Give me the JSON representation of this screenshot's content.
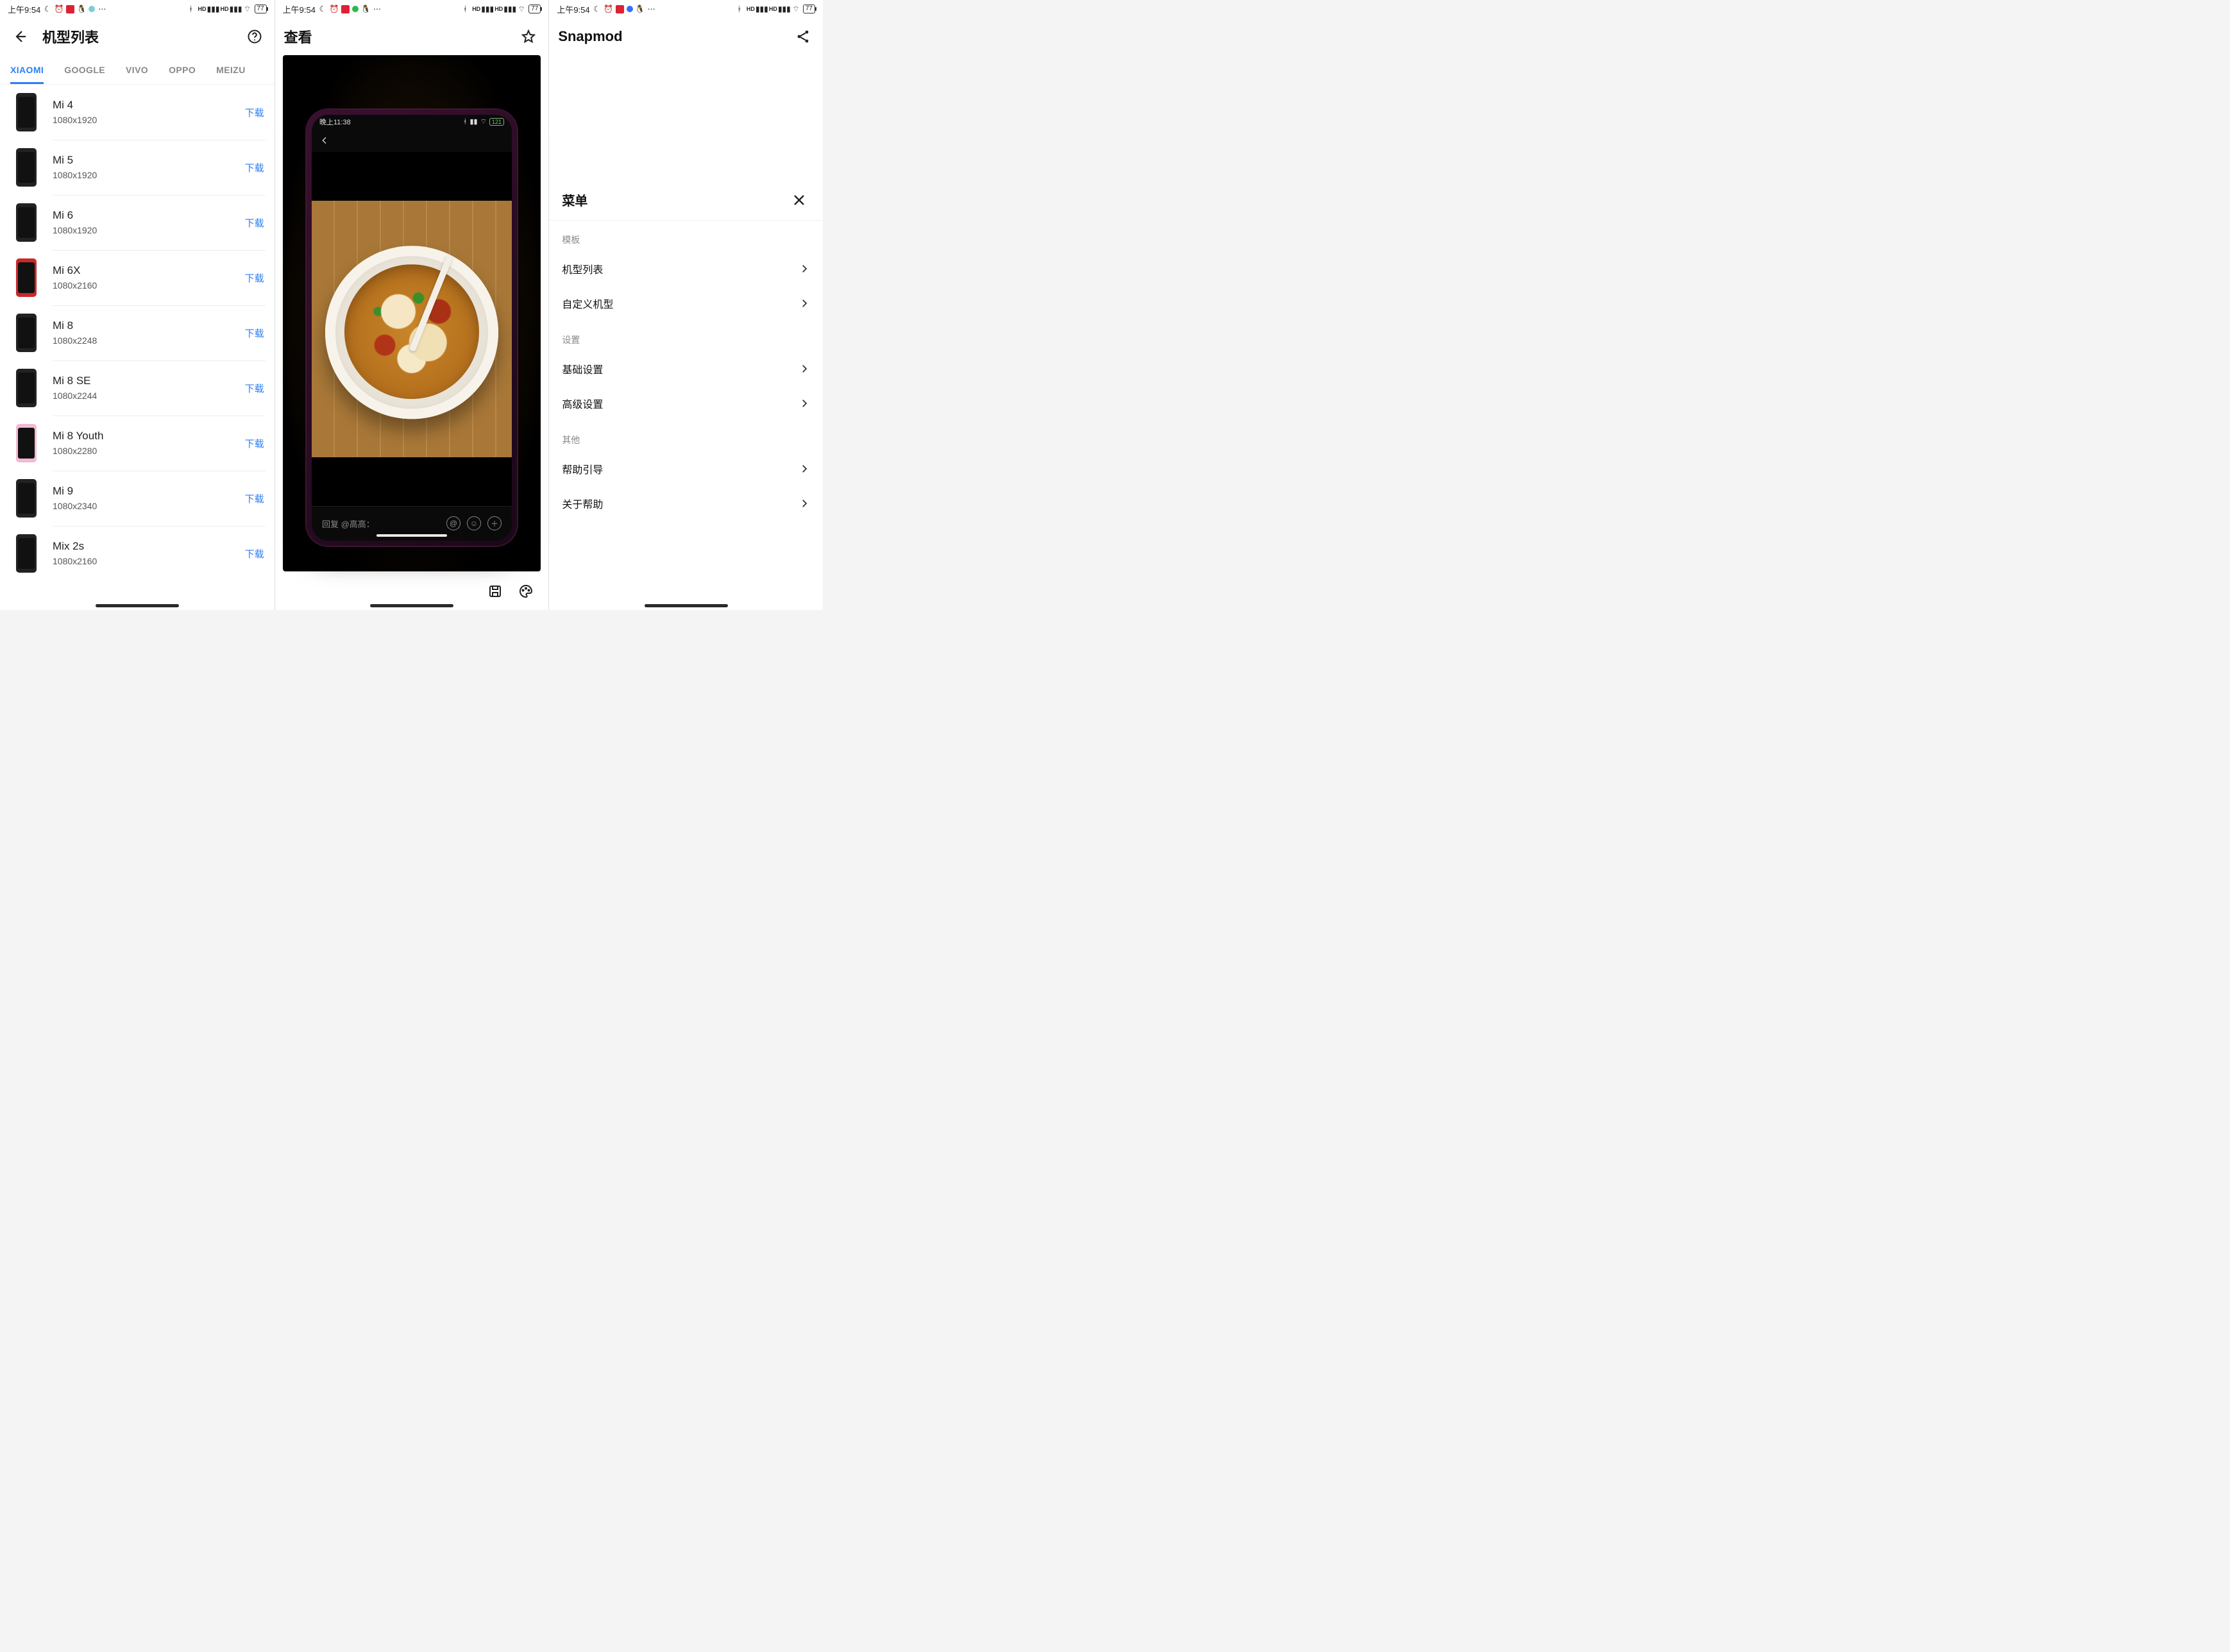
{
  "status": {
    "time": "上午9:54",
    "battery": "77"
  },
  "screen1": {
    "title": "机型列表",
    "tabs": [
      "XIAOMI",
      "GOOGLE",
      "VIVO",
      "OPPO",
      "MEIZU"
    ],
    "activeTab": 0,
    "action_label": "下载",
    "devices": [
      {
        "name": "Mi 4",
        "res": "1080x1920",
        "color": "black"
      },
      {
        "name": "Mi 5",
        "res": "1080x1920",
        "color": "black"
      },
      {
        "name": "Mi 6",
        "res": "1080x1920",
        "color": "black"
      },
      {
        "name": "Mi 6X",
        "res": "1080x2160",
        "color": "red"
      },
      {
        "name": "Mi 8",
        "res": "1080x2248",
        "color": "black"
      },
      {
        "name": "Mi 8 SE",
        "res": "1080x2244",
        "color": "black"
      },
      {
        "name": "Mi 8 Youth",
        "res": "1080x2280",
        "color": "pink"
      },
      {
        "name": "Mi 9",
        "res": "1080x2340",
        "color": "black"
      },
      {
        "name": "Mix 2s",
        "res": "1080x2160",
        "color": "black"
      }
    ]
  },
  "screen2": {
    "title": "查看",
    "inner_status_time": "晚上11:38",
    "inner_battery": "121",
    "reply_placeholder": "回复 @高高："
  },
  "screen3": {
    "title": "Snapmod",
    "sheet_title": "菜单",
    "sections": [
      {
        "label": "模板",
        "items": [
          "机型列表",
          "自定义机型"
        ]
      },
      {
        "label": "设置",
        "items": [
          "基础设置",
          "高级设置"
        ]
      },
      {
        "label": "其他",
        "items": [
          "帮助引导",
          "关于帮助"
        ]
      }
    ]
  }
}
